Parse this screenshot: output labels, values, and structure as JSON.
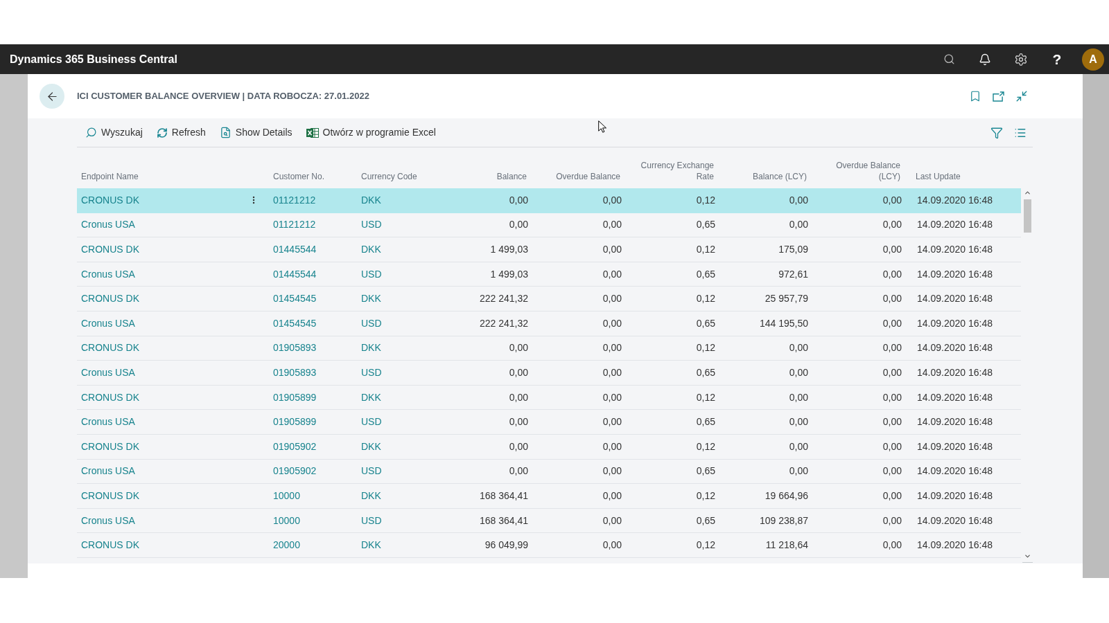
{
  "top_bar": {
    "app_title": "Dynamics 365 Business Central",
    "help": "?",
    "avatar_initial": "A"
  },
  "page": {
    "title": "ICI CUSTOMER BALANCE OVERVIEW | DATA ROBOCZA: 27.01.2022"
  },
  "toolbar": {
    "actions": [
      {
        "kind": "search",
        "label": "Wyszukaj"
      },
      {
        "kind": "refresh",
        "label": "Refresh"
      },
      {
        "kind": "details",
        "label": "Show Details"
      },
      {
        "kind": "excel",
        "label": "Otwórz w programie Excel"
      }
    ]
  },
  "table": {
    "columns": [
      {
        "label": "Endpoint Name",
        "kind": "link"
      },
      {
        "label": "Customer No.",
        "kind": "link"
      },
      {
        "label": "Currency Code",
        "kind": "link"
      },
      {
        "label": "Balance",
        "kind": "number"
      },
      {
        "label": "Overdue Balance",
        "kind": "number"
      },
      {
        "label": "Currency Exchange Rate",
        "kind": "number"
      },
      {
        "label": "Balance (LCY)",
        "kind": "number"
      },
      {
        "label": "Overdue Balance (LCY)",
        "kind": "number"
      },
      {
        "label": "Last Update",
        "kind": "text"
      }
    ],
    "rows": [
      {
        "selected": true,
        "cells": [
          "CRONUS DK",
          "01121212",
          "DKK",
          "0,00",
          "0,00",
          "0,12",
          "0,00",
          "0,00",
          "14.09.2020 16:48"
        ]
      },
      {
        "selected": false,
        "cells": [
          "Cronus USA",
          "01121212",
          "USD",
          "0,00",
          "0,00",
          "0,65",
          "0,00",
          "0,00",
          "14.09.2020 16:48"
        ]
      },
      {
        "selected": false,
        "cells": [
          "CRONUS DK",
          "01445544",
          "DKK",
          "1 499,03",
          "0,00",
          "0,12",
          "175,09",
          "0,00",
          "14.09.2020 16:48"
        ]
      },
      {
        "selected": false,
        "cells": [
          "Cronus USA",
          "01445544",
          "USD",
          "1 499,03",
          "0,00",
          "0,65",
          "972,61",
          "0,00",
          "14.09.2020 16:48"
        ]
      },
      {
        "selected": false,
        "cells": [
          "CRONUS DK",
          "01454545",
          "DKK",
          "222 241,32",
          "0,00",
          "0,12",
          "25 957,79",
          "0,00",
          "14.09.2020 16:48"
        ]
      },
      {
        "selected": false,
        "cells": [
          "Cronus USA",
          "01454545",
          "USD",
          "222 241,32",
          "0,00",
          "0,65",
          "144 195,50",
          "0,00",
          "14.09.2020 16:48"
        ]
      },
      {
        "selected": false,
        "cells": [
          "CRONUS DK",
          "01905893",
          "DKK",
          "0,00",
          "0,00",
          "0,12",
          "0,00",
          "0,00",
          "14.09.2020 16:48"
        ]
      },
      {
        "selected": false,
        "cells": [
          "Cronus USA",
          "01905893",
          "USD",
          "0,00",
          "0,00",
          "0,65",
          "0,00",
          "0,00",
          "14.09.2020 16:48"
        ]
      },
      {
        "selected": false,
        "cells": [
          "CRONUS DK",
          "01905899",
          "DKK",
          "0,00",
          "0,00",
          "0,12",
          "0,00",
          "0,00",
          "14.09.2020 16:48"
        ]
      },
      {
        "selected": false,
        "cells": [
          "Cronus USA",
          "01905899",
          "USD",
          "0,00",
          "0,00",
          "0,65",
          "0,00",
          "0,00",
          "14.09.2020 16:48"
        ]
      },
      {
        "selected": false,
        "cells": [
          "CRONUS DK",
          "01905902",
          "DKK",
          "0,00",
          "0,00",
          "0,12",
          "0,00",
          "0,00",
          "14.09.2020 16:48"
        ]
      },
      {
        "selected": false,
        "cells": [
          "Cronus USA",
          "01905902",
          "USD",
          "0,00",
          "0,00",
          "0,65",
          "0,00",
          "0,00",
          "14.09.2020 16:48"
        ]
      },
      {
        "selected": false,
        "cells": [
          "CRONUS DK",
          "10000",
          "DKK",
          "168 364,41",
          "0,00",
          "0,12",
          "19 664,96",
          "0,00",
          "14.09.2020 16:48"
        ]
      },
      {
        "selected": false,
        "cells": [
          "Cronus USA",
          "10000",
          "USD",
          "168 364,41",
          "0,00",
          "0,65",
          "109 238,87",
          "0,00",
          "14.09.2020 16:48"
        ]
      },
      {
        "selected": false,
        "cells": [
          "CRONUS DK",
          "20000",
          "DKK",
          "96 049,99",
          "0,00",
          "0,12",
          "11 218,64",
          "0,00",
          "14.09.2020 16:48"
        ]
      }
    ]
  }
}
